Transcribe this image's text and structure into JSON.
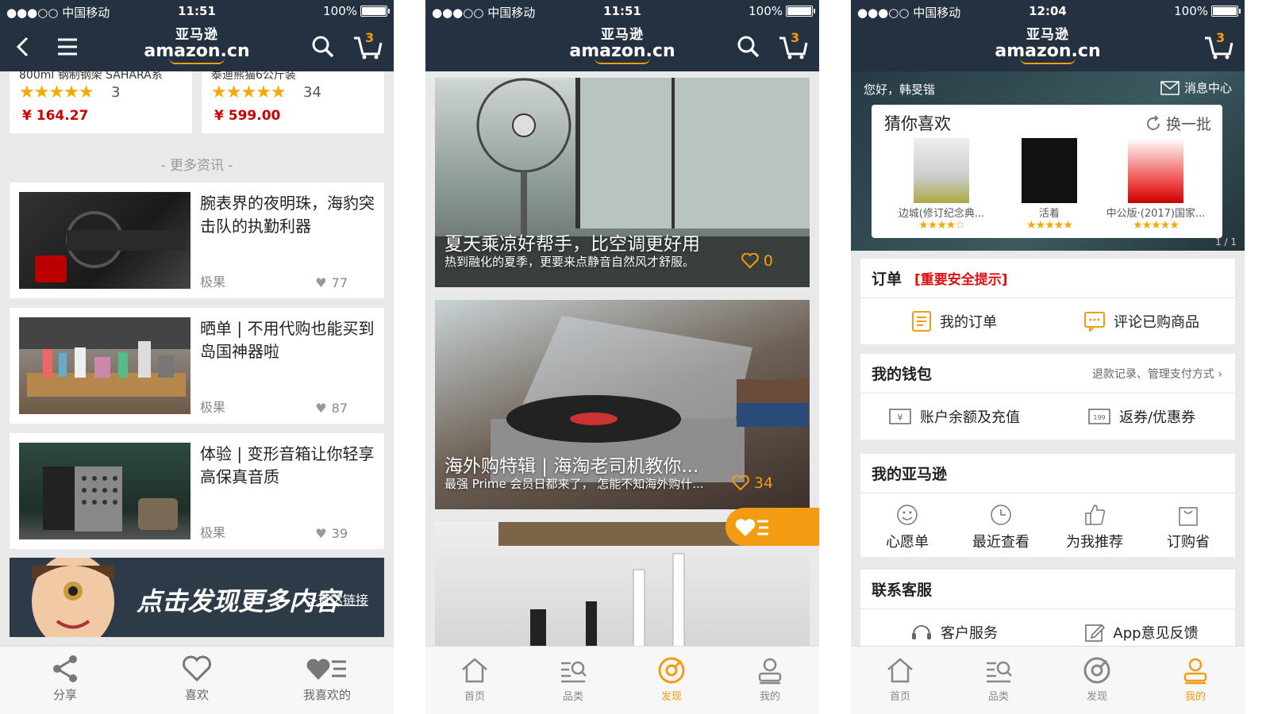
{
  "status": {
    "carrier": "●●●○○ 中国移动",
    "battery": "100%",
    "time1": "11:51",
    "time2": "11:51",
    "time3": "12:04"
  },
  "nav": {
    "logo_cn": "亚马逊",
    "logo_en": "amazon.cn",
    "cart_count": "3"
  },
  "screen1": {
    "products": [
      {
        "cut": "800ml 钢制钢架 SAHARA系",
        "rating_count": "3",
        "price": "¥ 164.27"
      },
      {
        "cut": "泰迪熊猫6公斤装",
        "rating_count": "34",
        "price": "¥ 599.00"
      }
    ],
    "more_info": "- 更多资讯 -",
    "news": [
      {
        "title": "腕表界的夜明珠，海豹突击队的执勤利器",
        "source": "极果",
        "likes": "77"
      },
      {
        "title": "晒单 | 不用代购也能买到岛国神器啦",
        "source": "极果",
        "likes": "87"
      },
      {
        "title": "体验 | 变形音箱让你轻享高保真音质",
        "source": "极果",
        "likes": "39"
      }
    ],
    "banner": {
      "slogan": "点击发现更多内容",
      "link": ">直达链接"
    },
    "bottom": {
      "share": "分享",
      "like": "喜欢",
      "my_likes": "我喜欢的"
    }
  },
  "screen2": {
    "cards": [
      {
        "title": "夏天乘凉好帮手，比空调更好用",
        "subtitle": "热到融化的夏季，更要来点静音自然风才舒服。",
        "likes": "0"
      },
      {
        "title": "海外购特辑 | 海淘老司机教你...",
        "subtitle": "最强 Prime 会员日都来了， 怎能不知海外购什...",
        "likes": "34"
      }
    ]
  },
  "tabs": [
    {
      "label": "首页",
      "icon": "home-icon"
    },
    {
      "label": "品类",
      "icon": "category-icon"
    },
    {
      "label": "发现",
      "icon": "discover-icon"
    },
    {
      "label": "我的",
      "icon": "profile-icon"
    }
  ],
  "screen3": {
    "greeting": "您好，韩旻锴",
    "message_center": "消息中心",
    "reco_title": "猜你喜欢",
    "refresh": "换一批",
    "books": [
      {
        "title": "边城(修订纪念典...",
        "stars": "★★★★☆"
      },
      {
        "title": "活着",
        "stars": "★★★★★"
      },
      {
        "title": "中公版·(2017)国家...",
        "stars": "★★★★★"
      }
    ],
    "pager": "1 / 1",
    "orders": {
      "title": "订单",
      "warning": "[重要安全提示]",
      "my_orders": "我的订单",
      "review": "评论已购商品"
    },
    "wallet": {
      "title": "我的钱包",
      "right": "退款记录、管理支付方式 ›",
      "balance": "账户余额及充值",
      "coupons": "返券/优惠券"
    },
    "my_amazon": {
      "title": "我的亚马逊",
      "items": [
        "心愿单",
        "最近查看",
        "为我推荐",
        "订购省"
      ]
    },
    "support": {
      "title": "联系客服",
      "service": "客户服务",
      "feedback": "App意见反馈"
    }
  },
  "colors": {
    "nav_bg": "#243140",
    "accent": "#f39c12",
    "price": "#cc0000",
    "warning": "#e01010"
  }
}
